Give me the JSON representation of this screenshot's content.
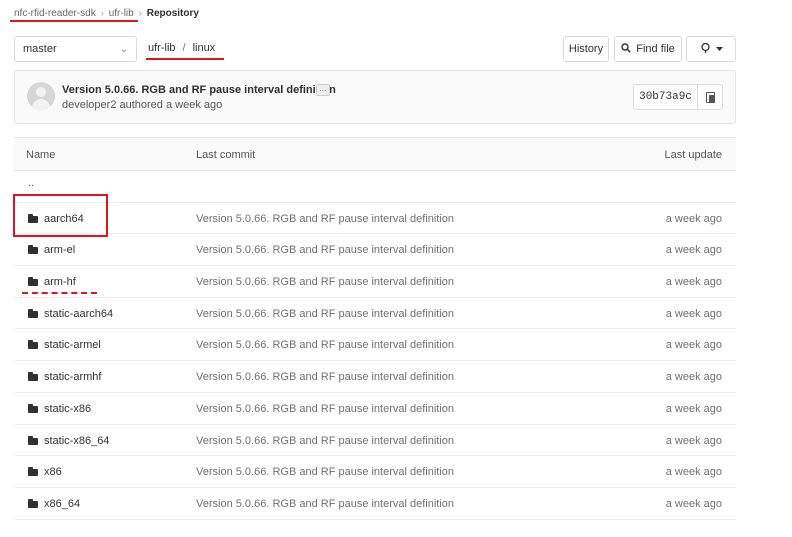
{
  "breadcrumb": {
    "items": [
      "nfc-rfid-reader-sdk",
      "ufr-lib",
      "Repository"
    ]
  },
  "toolbar": {
    "branch": "master",
    "path": [
      "ufr-lib",
      "linux"
    ],
    "history_label": "History",
    "find_file_label": "Find file",
    "clone_icon": "download-icon",
    "caret_icon": "chevron-down-icon"
  },
  "commit": {
    "title": "Version 5.0.66. RGB and RF pause interval definition",
    "ellipsis": "...",
    "author_line": "developer2 authored a week ago",
    "sha": "30b73a9c",
    "copy_icon": "copy-icon"
  },
  "table": {
    "headers": {
      "name": "Name",
      "last_commit": "Last commit",
      "last_update": "Last update"
    },
    "parent": "..",
    "rows": [
      {
        "name": "aarch64",
        "commit": "Version 5.0.66. RGB and RF pause interval definition",
        "update": "a week ago"
      },
      {
        "name": "arm-el",
        "commit": "Version 5.0.66. RGB and RF pause interval definition",
        "update": "a week ago"
      },
      {
        "name": "arm-hf",
        "commit": "Version 5.0.66. RGB and RF pause interval definition",
        "update": "a week ago"
      },
      {
        "name": "static-aarch64",
        "commit": "Version 5.0.66. RGB and RF pause interval definition",
        "update": "a week ago"
      },
      {
        "name": "static-armel",
        "commit": "Version 5.0.66. RGB and RF pause interval definition",
        "update": "a week ago"
      },
      {
        "name": "static-armhf",
        "commit": "Version 5.0.66. RGB and RF pause interval definition",
        "update": "a week ago"
      },
      {
        "name": "static-x86",
        "commit": "Version 5.0.66. RGB and RF pause interval definition",
        "update": "a week ago"
      },
      {
        "name": "static-x86_64",
        "commit": "Version 5.0.66. RGB and RF pause interval definition",
        "update": "a week ago"
      },
      {
        "name": "x86",
        "commit": "Version 5.0.66. RGB and RF pause interval definition",
        "update": "a week ago"
      },
      {
        "name": "x86_64",
        "commit": "Version 5.0.66. RGB and RF pause interval definition",
        "update": "a week ago"
      }
    ]
  },
  "colors": {
    "annotation": "#e0141f",
    "border": "#e5e5e5",
    "text": "#303030"
  }
}
